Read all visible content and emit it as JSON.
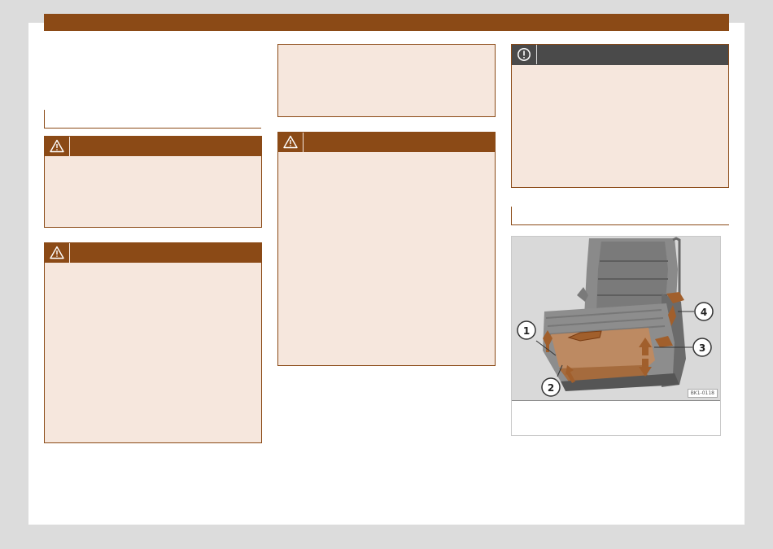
{
  "figure": {
    "code": "BK1-0118",
    "callouts": [
      "1",
      "2",
      "3",
      "4"
    ]
  },
  "icons": {
    "warning": "warning-triangle-icon",
    "note": "exclamation-circle-icon"
  },
  "colors": {
    "accent": "#8b4a16",
    "box_fill": "#f6e7dd",
    "note_header": "#4a4a4a",
    "page_bg": "#dcdcdc"
  }
}
